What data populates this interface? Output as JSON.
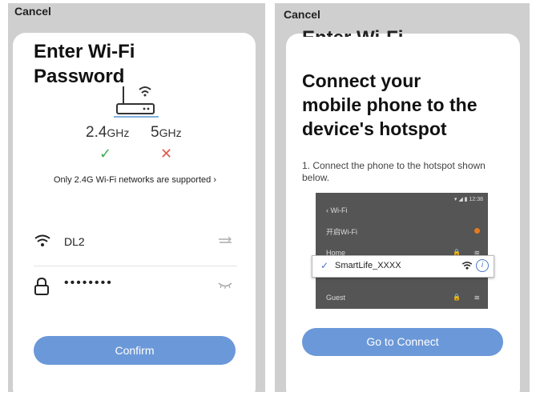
{
  "left": {
    "cancel_label": "Cancel",
    "title_line1": "Enter Wi-Fi",
    "title_line2": "Password",
    "band_24": {
      "value": "2.4",
      "unit": "GHz"
    },
    "band_5": {
      "value": "5",
      "unit": "GHz"
    },
    "support_note": "Only 2.4G Wi-Fi networks are supported",
    "ssid_value": "DL2",
    "password_value": "••••••••",
    "confirm_label": "Confirm"
  },
  "right": {
    "cancel_label": "Cancel",
    "behind_title": "Enter Wi-Fi",
    "title_line1": "Connect your",
    "title_line2": "mobile phone to the",
    "title_line3": "device's hotspot",
    "step_text": "1. Connect the phone to the hotspot shown below.",
    "phone": {
      "status_time": "12:38",
      "back_label": "Wi-Fi",
      "toggle_label": "开启Wi-Fi",
      "home_label": "Home",
      "guest_label": "Guest"
    },
    "popup_ssid": "SmartLife_XXXX",
    "go_connect_label": "Go to Connect"
  },
  "colors": {
    "accent_button": "#6b98d8",
    "check_green": "#3dac52",
    "cross_red": "#e05a4e",
    "info_blue": "#4a78c8"
  },
  "icons": [
    "router-icon",
    "check-icon",
    "cross-icon",
    "chevron-right-icon",
    "wifi-icon",
    "lock-icon",
    "swap-icon",
    "eye-closed-icon",
    "info-icon"
  ]
}
